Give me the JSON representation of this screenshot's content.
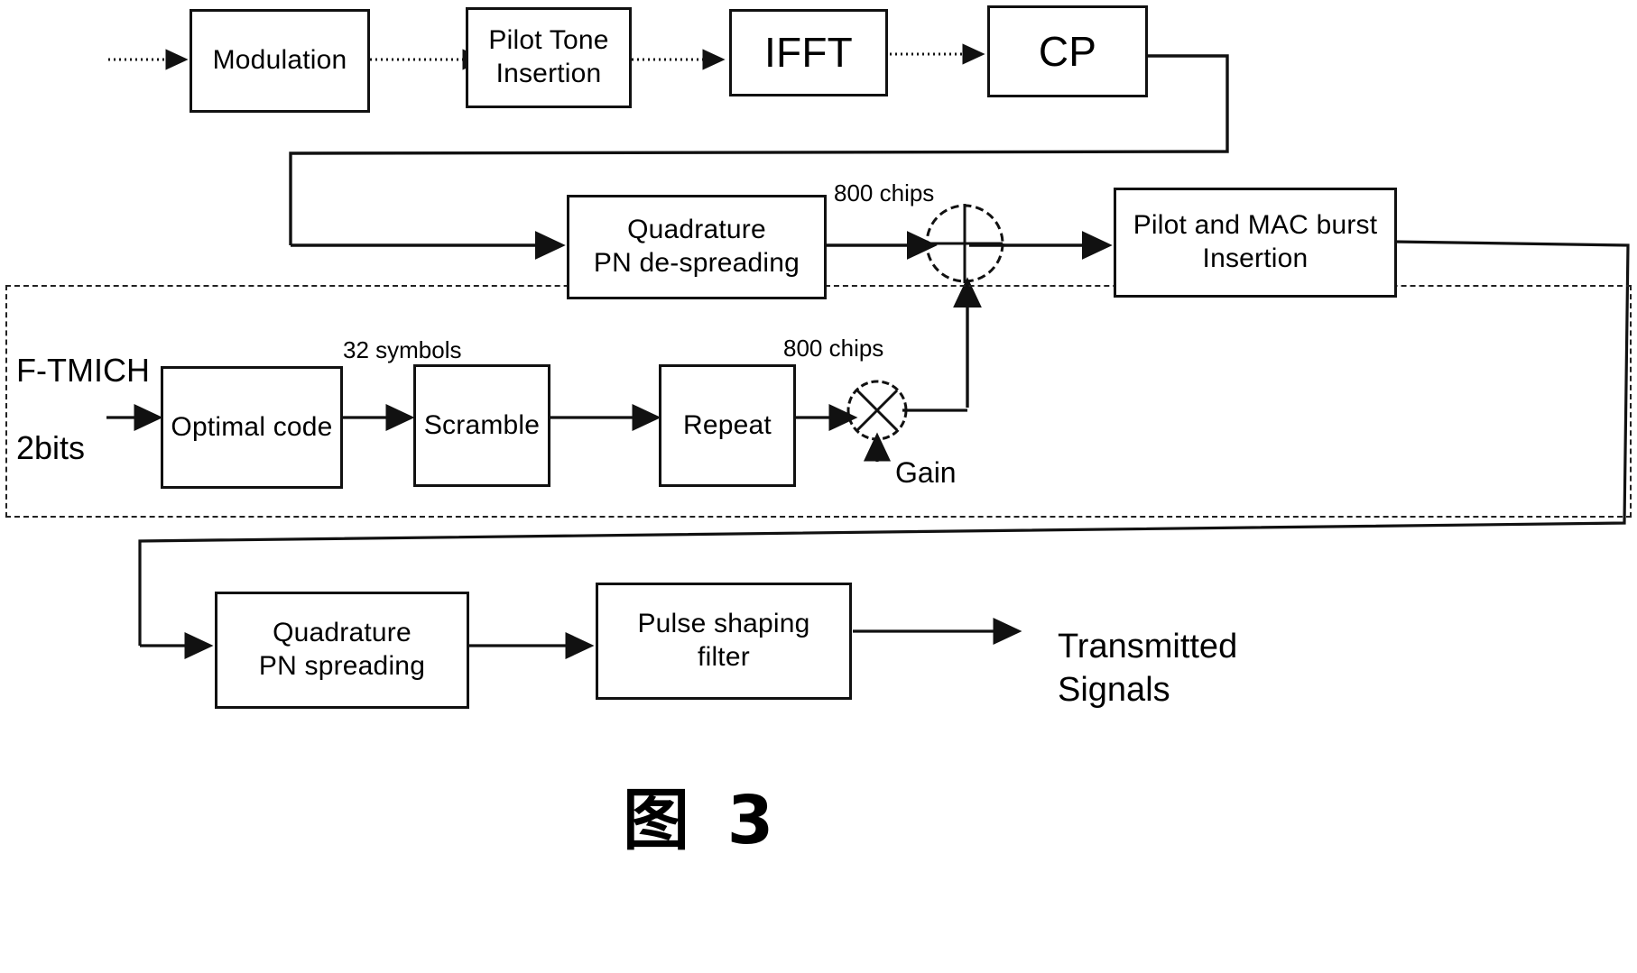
{
  "figure": {
    "caption": "图 3",
    "title_glyph": "图",
    "number": "3"
  },
  "blocks": [
    {
      "id": "modulation",
      "label": "Modulation"
    },
    {
      "id": "pilot-tone",
      "label": "Pilot Tone\nInsertion"
    },
    {
      "id": "ifft",
      "label": "IFFT"
    },
    {
      "id": "cp",
      "label": "CP"
    },
    {
      "id": "pn-despreading",
      "label": "Quadrature\nPN de-spreading"
    },
    {
      "id": "pilot-mac-burst",
      "label": "Pilot and MAC burst\nInsertion"
    },
    {
      "id": "optimal-code",
      "label": "Optimal code"
    },
    {
      "id": "scramble",
      "label": "Scramble"
    },
    {
      "id": "repeat",
      "label": "Repeat"
    },
    {
      "id": "pn-spreading",
      "label": "Quadrature\nPN spreading"
    },
    {
      "id": "pulse-shaping",
      "label": "Pulse shaping\nfilter"
    }
  ],
  "labels": {
    "input_channel": "F-TMICH",
    "input_bits": "2bits",
    "symbols_32": "32 symbols",
    "chips_800_top": "800 chips",
    "chips_800_mid": "800 chips",
    "gain": "Gain",
    "output": "Transmitted\nSignals"
  },
  "operators": [
    {
      "id": "summer",
      "symbol": "+",
      "name": "adder"
    },
    {
      "id": "multiplier",
      "symbol": "x",
      "name": "multiplier"
    }
  ],
  "colors": {
    "stroke": "#111111",
    "background": "#ffffff",
    "text": "#000000"
  }
}
